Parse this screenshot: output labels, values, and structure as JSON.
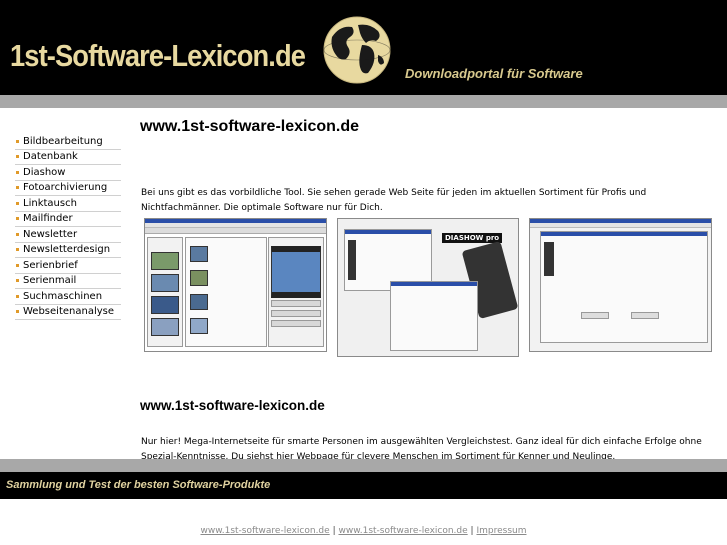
{
  "header": {
    "logo_text": "1st-Software-Lexicon.de",
    "tagline": "Downloadportal für Software"
  },
  "sidebar": {
    "items": [
      {
        "label": "Bildbearbeitung"
      },
      {
        "label": "Datenbank"
      },
      {
        "label": "Diashow"
      },
      {
        "label": "Fotoarchivierung"
      },
      {
        "label": "Linktausch"
      },
      {
        "label": "Mailfinder"
      },
      {
        "label": "Newsletter"
      },
      {
        "label": "Newsletterdesign"
      },
      {
        "label": "Serienbrief"
      },
      {
        "label": "Serienmail"
      },
      {
        "label": "Suchmaschinen"
      },
      {
        "label": "Webseitenanalyse"
      }
    ]
  },
  "main": {
    "heading_1": "www.1st-software-lexicon.de",
    "paragraph_1": "Bei uns gibt es das vorbildliche Tool. Sie sehen gerade Web Seite für jeden im aktuellen Sortiment für Profis und Nichtfachmänner. Die optimale Software nur für Dich.",
    "screenshot_2_label": "DIASHOW pro",
    "heading_2": "www.1st-software-lexicon.de",
    "paragraph_2": "Nur hier! Mega-Internetseite für smarte Personen im ausgewählten Vergleichstest. Ganz ideal für dich einfache Erfolge ohne Spezial-Kenntnisse. Du siehst hier Webpage für clevere Menschen im Sortiment für Kenner und Neulinge."
  },
  "footer": {
    "slogan": "Sammlung und Test der besten Software-Produkte",
    "links": [
      {
        "label": "www.1st-software-lexicon.de"
      },
      {
        "label": "www.1st-software-lexicon.de"
      },
      {
        "label": "Impressum"
      }
    ],
    "separator": "|"
  },
  "colors": {
    "header_bg": "#000000",
    "logo_gold": "#e8d9a0",
    "grey_bar": "#a8a8a8",
    "nav_bullet": "#e09a2a",
    "footer_link": "#8a8a8a"
  }
}
